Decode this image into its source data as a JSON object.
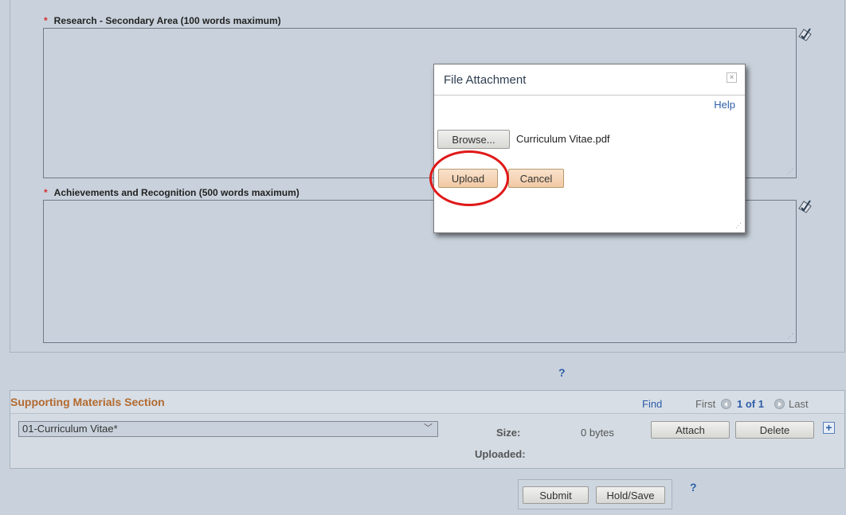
{
  "form": {
    "research_label": "Research - Secondary Area (100 words maximum)",
    "achievements_label": "Achievements and Recognition (500 words maximum)",
    "required_marker": "*",
    "help_marker": "?"
  },
  "supporting": {
    "title": "Supporting Materials Section",
    "find": "Find",
    "first": "First",
    "page": "1 of 1",
    "last": "Last",
    "selected_value": "01-Curriculum Vitae*",
    "size_label": "Size:",
    "size_value": "0 bytes",
    "uploaded_label": "Uploaded:",
    "attach_label": "Attach",
    "delete_label": "Delete",
    "plus": "+"
  },
  "actions": {
    "submit_label": "Submit",
    "hold_label": "Hold/Save",
    "help_marker": "?"
  },
  "dialog": {
    "title": "File Attachment",
    "close": "×",
    "help": "Help",
    "browse_label": "Browse...",
    "filename": "Curriculum Vitae.pdf",
    "upload_label": "Upload",
    "cancel_label": "Cancel"
  },
  "colors": {
    "background": "#c9d2dc",
    "section_title": "#b26a2f",
    "link": "#2d5da8",
    "required": "#d32f2f",
    "highlight": "#e01818"
  }
}
